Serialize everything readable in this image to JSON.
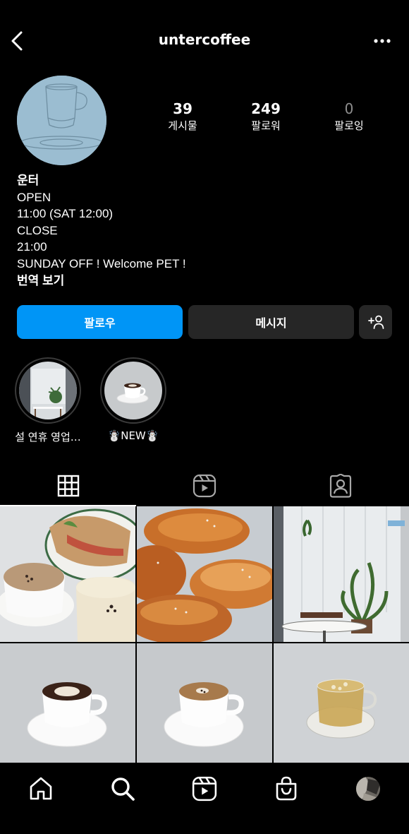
{
  "header": {
    "username": "untercoffee"
  },
  "profile": {
    "stats": [
      {
        "value": "39",
        "label": "게시물"
      },
      {
        "value": "249",
        "label": "팔로워"
      },
      {
        "value": "0",
        "label": "팔로잉"
      }
    ],
    "bio": {
      "name": "운터",
      "lines": [
        "OPEN",
        "11:00 (SAT 12:00)",
        "CLOSE",
        "21:00",
        "SUNDAY OFF ! Welcome PET !"
      ],
      "translate": "번역 보기"
    }
  },
  "buttons": {
    "follow": "팔로우",
    "message": "메시지"
  },
  "highlights": [
    {
      "label": "설 연휴 영업…"
    },
    {
      "label": "☃️NEW☃️"
    }
  ],
  "tabs": [
    "grid-icon",
    "reels-icon",
    "tagged-icon"
  ],
  "nav": [
    "home-icon",
    "search-icon",
    "reels-icon",
    "shop-icon",
    "profile-avatar"
  ],
  "colors": {
    "accent": "#0095f6",
    "button_dark": "#262626",
    "avatar_bg": "#9bbdd1"
  }
}
